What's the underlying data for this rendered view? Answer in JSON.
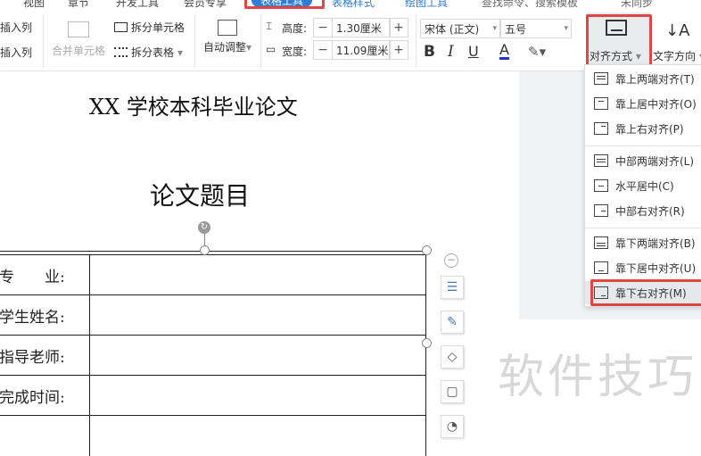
{
  "tabs": [
    "视图",
    "章节",
    "开发工具",
    "会员专享",
    "表格工具",
    "表格样式",
    "绘图工具",
    "查找命令、搜索模板",
    "未同步"
  ],
  "ribbon": {
    "insert_col_left": "插入列",
    "insert_col_right": "插入列",
    "merge_cells": "合并单元格",
    "split_cells": "拆分单元格",
    "split_table": "拆分表格",
    "auto_fit": "自动调整",
    "height_label": "高度:",
    "height_value": "1.30厘米",
    "width_label": "宽度:",
    "width_value": "11.09厘米",
    "font_name": "宋体 (正文)",
    "font_size": "五号",
    "bold": "B",
    "italic": "I",
    "underline": "U",
    "font_color": "A",
    "align_label": "对齐方式",
    "text_dir_label": "文字方向",
    "accent": "#2f7bd6"
  },
  "align_menu": [
    {
      "label": "靠上两端对齐(T)"
    },
    {
      "label": "靠上居中对齐(O)"
    },
    {
      "label": "靠上右对齐(P)"
    },
    {
      "label": "中部两端对齐(L)"
    },
    {
      "label": "水平居中(C)"
    },
    {
      "label": "中部右对齐(R)"
    },
    {
      "label": "靠下两端对齐(B)"
    },
    {
      "label": "靠下居中对齐(U)"
    },
    {
      "label": "靠下右对齐(M)"
    }
  ],
  "document": {
    "title": "XX 学校本科毕业论文",
    "subtitle": "论文题目",
    "rows": [
      "专　　业:",
      "学生姓名:",
      "指导老师:",
      "完成时间:"
    ]
  },
  "watermark": "软件技巧"
}
